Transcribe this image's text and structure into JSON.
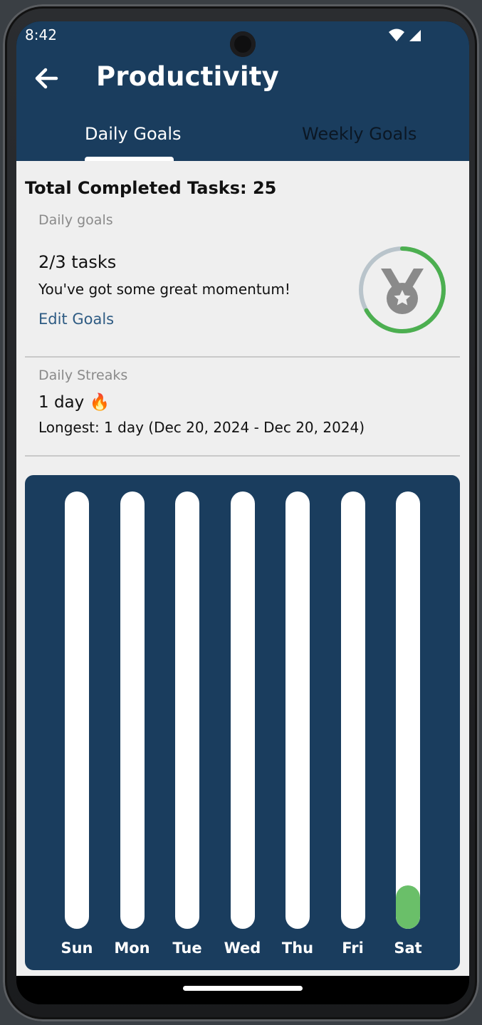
{
  "status_bar": {
    "time": "8:42",
    "wifi_icon": "wifi-icon",
    "signal_icon": "signal-icon"
  },
  "header": {
    "title": "Productivity",
    "back_icon": "arrow-left-icon",
    "tabs": [
      {
        "label": "Daily Goals",
        "selected": true
      },
      {
        "label": "Weekly Goals",
        "selected": false
      }
    ]
  },
  "summary": {
    "total_completed": "Total Completed Tasks: 25"
  },
  "daily_goals": {
    "section_label": "Daily goals",
    "tasks": "2/3 tasks",
    "message": "You've got some great momentum!",
    "edit_label": "Edit Goals",
    "progress_fraction": 0.6667,
    "medal_icon": "medal-icon",
    "progress_color": "#4caf50"
  },
  "daily_streaks": {
    "section_label": "Daily Streaks",
    "current": "1 day 🔥",
    "longest": "Longest: 1 day (Dec 20, 2024 - Dec 20, 2024)"
  },
  "colors": {
    "primary": "#1a3d5e",
    "accent_green": "#6abf69",
    "background": "#efefef"
  },
  "chart_data": {
    "type": "bar",
    "categories": [
      "Sun",
      "Mon",
      "Tue",
      "Wed",
      "Thu",
      "Fri",
      "Sat"
    ],
    "values": [
      0,
      0,
      0,
      0,
      0,
      0,
      0.1
    ],
    "ylim": [
      0,
      1
    ]
  }
}
